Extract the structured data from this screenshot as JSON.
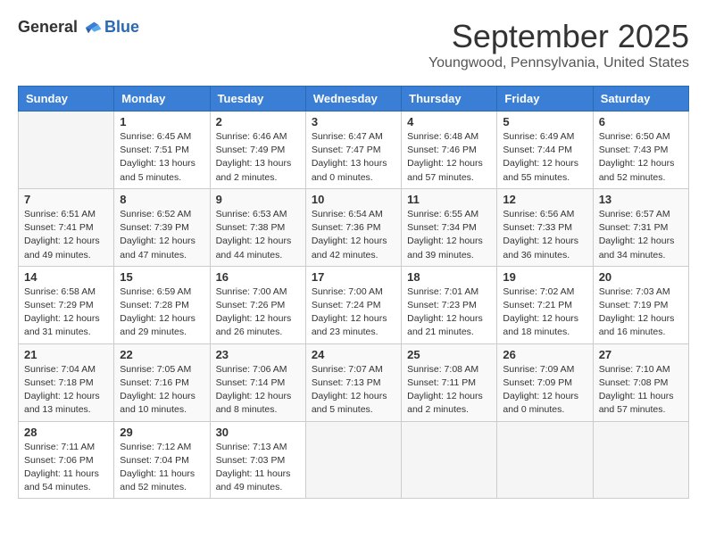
{
  "header": {
    "logo_general": "General",
    "logo_blue": "Blue",
    "month_title": "September 2025",
    "subtitle": "Youngwood, Pennsylvania, United States"
  },
  "days_of_week": [
    "Sunday",
    "Monday",
    "Tuesday",
    "Wednesday",
    "Thursday",
    "Friday",
    "Saturday"
  ],
  "weeks": [
    [
      {
        "day": "",
        "sunrise": "",
        "sunset": "",
        "daylight": ""
      },
      {
        "day": "1",
        "sunrise": "Sunrise: 6:45 AM",
        "sunset": "Sunset: 7:51 PM",
        "daylight": "Daylight: 13 hours and 5 minutes."
      },
      {
        "day": "2",
        "sunrise": "Sunrise: 6:46 AM",
        "sunset": "Sunset: 7:49 PM",
        "daylight": "Daylight: 13 hours and 2 minutes."
      },
      {
        "day": "3",
        "sunrise": "Sunrise: 6:47 AM",
        "sunset": "Sunset: 7:47 PM",
        "daylight": "Daylight: 13 hours and 0 minutes."
      },
      {
        "day": "4",
        "sunrise": "Sunrise: 6:48 AM",
        "sunset": "Sunset: 7:46 PM",
        "daylight": "Daylight: 12 hours and 57 minutes."
      },
      {
        "day": "5",
        "sunrise": "Sunrise: 6:49 AM",
        "sunset": "Sunset: 7:44 PM",
        "daylight": "Daylight: 12 hours and 55 minutes."
      },
      {
        "day": "6",
        "sunrise": "Sunrise: 6:50 AM",
        "sunset": "Sunset: 7:43 PM",
        "daylight": "Daylight: 12 hours and 52 minutes."
      }
    ],
    [
      {
        "day": "7",
        "sunrise": "Sunrise: 6:51 AM",
        "sunset": "Sunset: 7:41 PM",
        "daylight": "Daylight: 12 hours and 49 minutes."
      },
      {
        "day": "8",
        "sunrise": "Sunrise: 6:52 AM",
        "sunset": "Sunset: 7:39 PM",
        "daylight": "Daylight: 12 hours and 47 minutes."
      },
      {
        "day": "9",
        "sunrise": "Sunrise: 6:53 AM",
        "sunset": "Sunset: 7:38 PM",
        "daylight": "Daylight: 12 hours and 44 minutes."
      },
      {
        "day": "10",
        "sunrise": "Sunrise: 6:54 AM",
        "sunset": "Sunset: 7:36 PM",
        "daylight": "Daylight: 12 hours and 42 minutes."
      },
      {
        "day": "11",
        "sunrise": "Sunrise: 6:55 AM",
        "sunset": "Sunset: 7:34 PM",
        "daylight": "Daylight: 12 hours and 39 minutes."
      },
      {
        "day": "12",
        "sunrise": "Sunrise: 6:56 AM",
        "sunset": "Sunset: 7:33 PM",
        "daylight": "Daylight: 12 hours and 36 minutes."
      },
      {
        "day": "13",
        "sunrise": "Sunrise: 6:57 AM",
        "sunset": "Sunset: 7:31 PM",
        "daylight": "Daylight: 12 hours and 34 minutes."
      }
    ],
    [
      {
        "day": "14",
        "sunrise": "Sunrise: 6:58 AM",
        "sunset": "Sunset: 7:29 PM",
        "daylight": "Daylight: 12 hours and 31 minutes."
      },
      {
        "day": "15",
        "sunrise": "Sunrise: 6:59 AM",
        "sunset": "Sunset: 7:28 PM",
        "daylight": "Daylight: 12 hours and 29 minutes."
      },
      {
        "day": "16",
        "sunrise": "Sunrise: 7:00 AM",
        "sunset": "Sunset: 7:26 PM",
        "daylight": "Daylight: 12 hours and 26 minutes."
      },
      {
        "day": "17",
        "sunrise": "Sunrise: 7:00 AM",
        "sunset": "Sunset: 7:24 PM",
        "daylight": "Daylight: 12 hours and 23 minutes."
      },
      {
        "day": "18",
        "sunrise": "Sunrise: 7:01 AM",
        "sunset": "Sunset: 7:23 PM",
        "daylight": "Daylight: 12 hours and 21 minutes."
      },
      {
        "day": "19",
        "sunrise": "Sunrise: 7:02 AM",
        "sunset": "Sunset: 7:21 PM",
        "daylight": "Daylight: 12 hours and 18 minutes."
      },
      {
        "day": "20",
        "sunrise": "Sunrise: 7:03 AM",
        "sunset": "Sunset: 7:19 PM",
        "daylight": "Daylight: 12 hours and 16 minutes."
      }
    ],
    [
      {
        "day": "21",
        "sunrise": "Sunrise: 7:04 AM",
        "sunset": "Sunset: 7:18 PM",
        "daylight": "Daylight: 12 hours and 13 minutes."
      },
      {
        "day": "22",
        "sunrise": "Sunrise: 7:05 AM",
        "sunset": "Sunset: 7:16 PM",
        "daylight": "Daylight: 12 hours and 10 minutes."
      },
      {
        "day": "23",
        "sunrise": "Sunrise: 7:06 AM",
        "sunset": "Sunset: 7:14 PM",
        "daylight": "Daylight: 12 hours and 8 minutes."
      },
      {
        "day": "24",
        "sunrise": "Sunrise: 7:07 AM",
        "sunset": "Sunset: 7:13 PM",
        "daylight": "Daylight: 12 hours and 5 minutes."
      },
      {
        "day": "25",
        "sunrise": "Sunrise: 7:08 AM",
        "sunset": "Sunset: 7:11 PM",
        "daylight": "Daylight: 12 hours and 2 minutes."
      },
      {
        "day": "26",
        "sunrise": "Sunrise: 7:09 AM",
        "sunset": "Sunset: 7:09 PM",
        "daylight": "Daylight: 12 hours and 0 minutes."
      },
      {
        "day": "27",
        "sunrise": "Sunrise: 7:10 AM",
        "sunset": "Sunset: 7:08 PM",
        "daylight": "Daylight: 11 hours and 57 minutes."
      }
    ],
    [
      {
        "day": "28",
        "sunrise": "Sunrise: 7:11 AM",
        "sunset": "Sunset: 7:06 PM",
        "daylight": "Daylight: 11 hours and 54 minutes."
      },
      {
        "day": "29",
        "sunrise": "Sunrise: 7:12 AM",
        "sunset": "Sunset: 7:04 PM",
        "daylight": "Daylight: 11 hours and 52 minutes."
      },
      {
        "day": "30",
        "sunrise": "Sunrise: 7:13 AM",
        "sunset": "Sunset: 7:03 PM",
        "daylight": "Daylight: 11 hours and 49 minutes."
      },
      {
        "day": "",
        "sunrise": "",
        "sunset": "",
        "daylight": ""
      },
      {
        "day": "",
        "sunrise": "",
        "sunset": "",
        "daylight": ""
      },
      {
        "day": "",
        "sunrise": "",
        "sunset": "",
        "daylight": ""
      },
      {
        "day": "",
        "sunrise": "",
        "sunset": "",
        "daylight": ""
      }
    ]
  ]
}
